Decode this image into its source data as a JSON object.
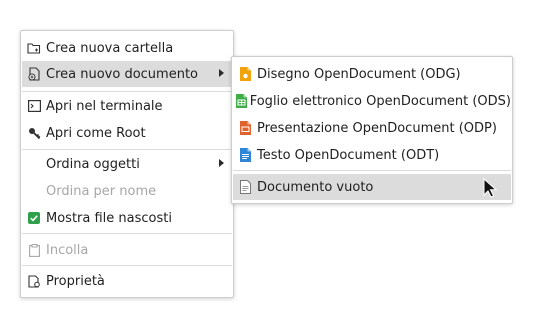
{
  "context_menu": {
    "items": [
      {
        "label": "Crea nuova cartella",
        "icon": "folder-new-icon"
      },
      {
        "label": "Crea nuovo documento",
        "icon": "document-new-icon",
        "submenu": true
      },
      {
        "label": "Apri nel terminale",
        "icon": "terminal-icon"
      },
      {
        "label": "Apri come Root",
        "icon": "key-icon"
      },
      {
        "label": "Ordina oggetti",
        "submenu": true
      },
      {
        "label": "Ordina per nome",
        "disabled": true
      },
      {
        "label": "Mostra file nascosti",
        "icon": "checkbox-checked-icon",
        "checked": true
      },
      {
        "label": "Incolla",
        "icon": "clipboard-icon",
        "disabled": true
      },
      {
        "label": "Proprietà",
        "icon": "properties-icon"
      }
    ]
  },
  "submenu": {
    "items": [
      {
        "label": "Disegno OpenDocument (ODG)",
        "icon": "drawing-doc-icon",
        "color": "#f0a30a"
      },
      {
        "label": "Foglio elettronico OpenDocument (ODS)",
        "icon": "spreadsheet-doc-icon",
        "color": "#3fae49"
      },
      {
        "label": "Presentazione OpenDocument (ODP)",
        "icon": "presentation-doc-icon",
        "color": "#e0632e"
      },
      {
        "label": "Testo OpenDocument (ODT)",
        "icon": "text-doc-icon",
        "color": "#2f86d6"
      },
      {
        "label": "Documento vuoto",
        "icon": "blank-doc-icon"
      }
    ]
  },
  "colors": {
    "check": "#2fa14a",
    "hover": "#dcdcdc",
    "disabled_text": "#a7a7a7"
  }
}
